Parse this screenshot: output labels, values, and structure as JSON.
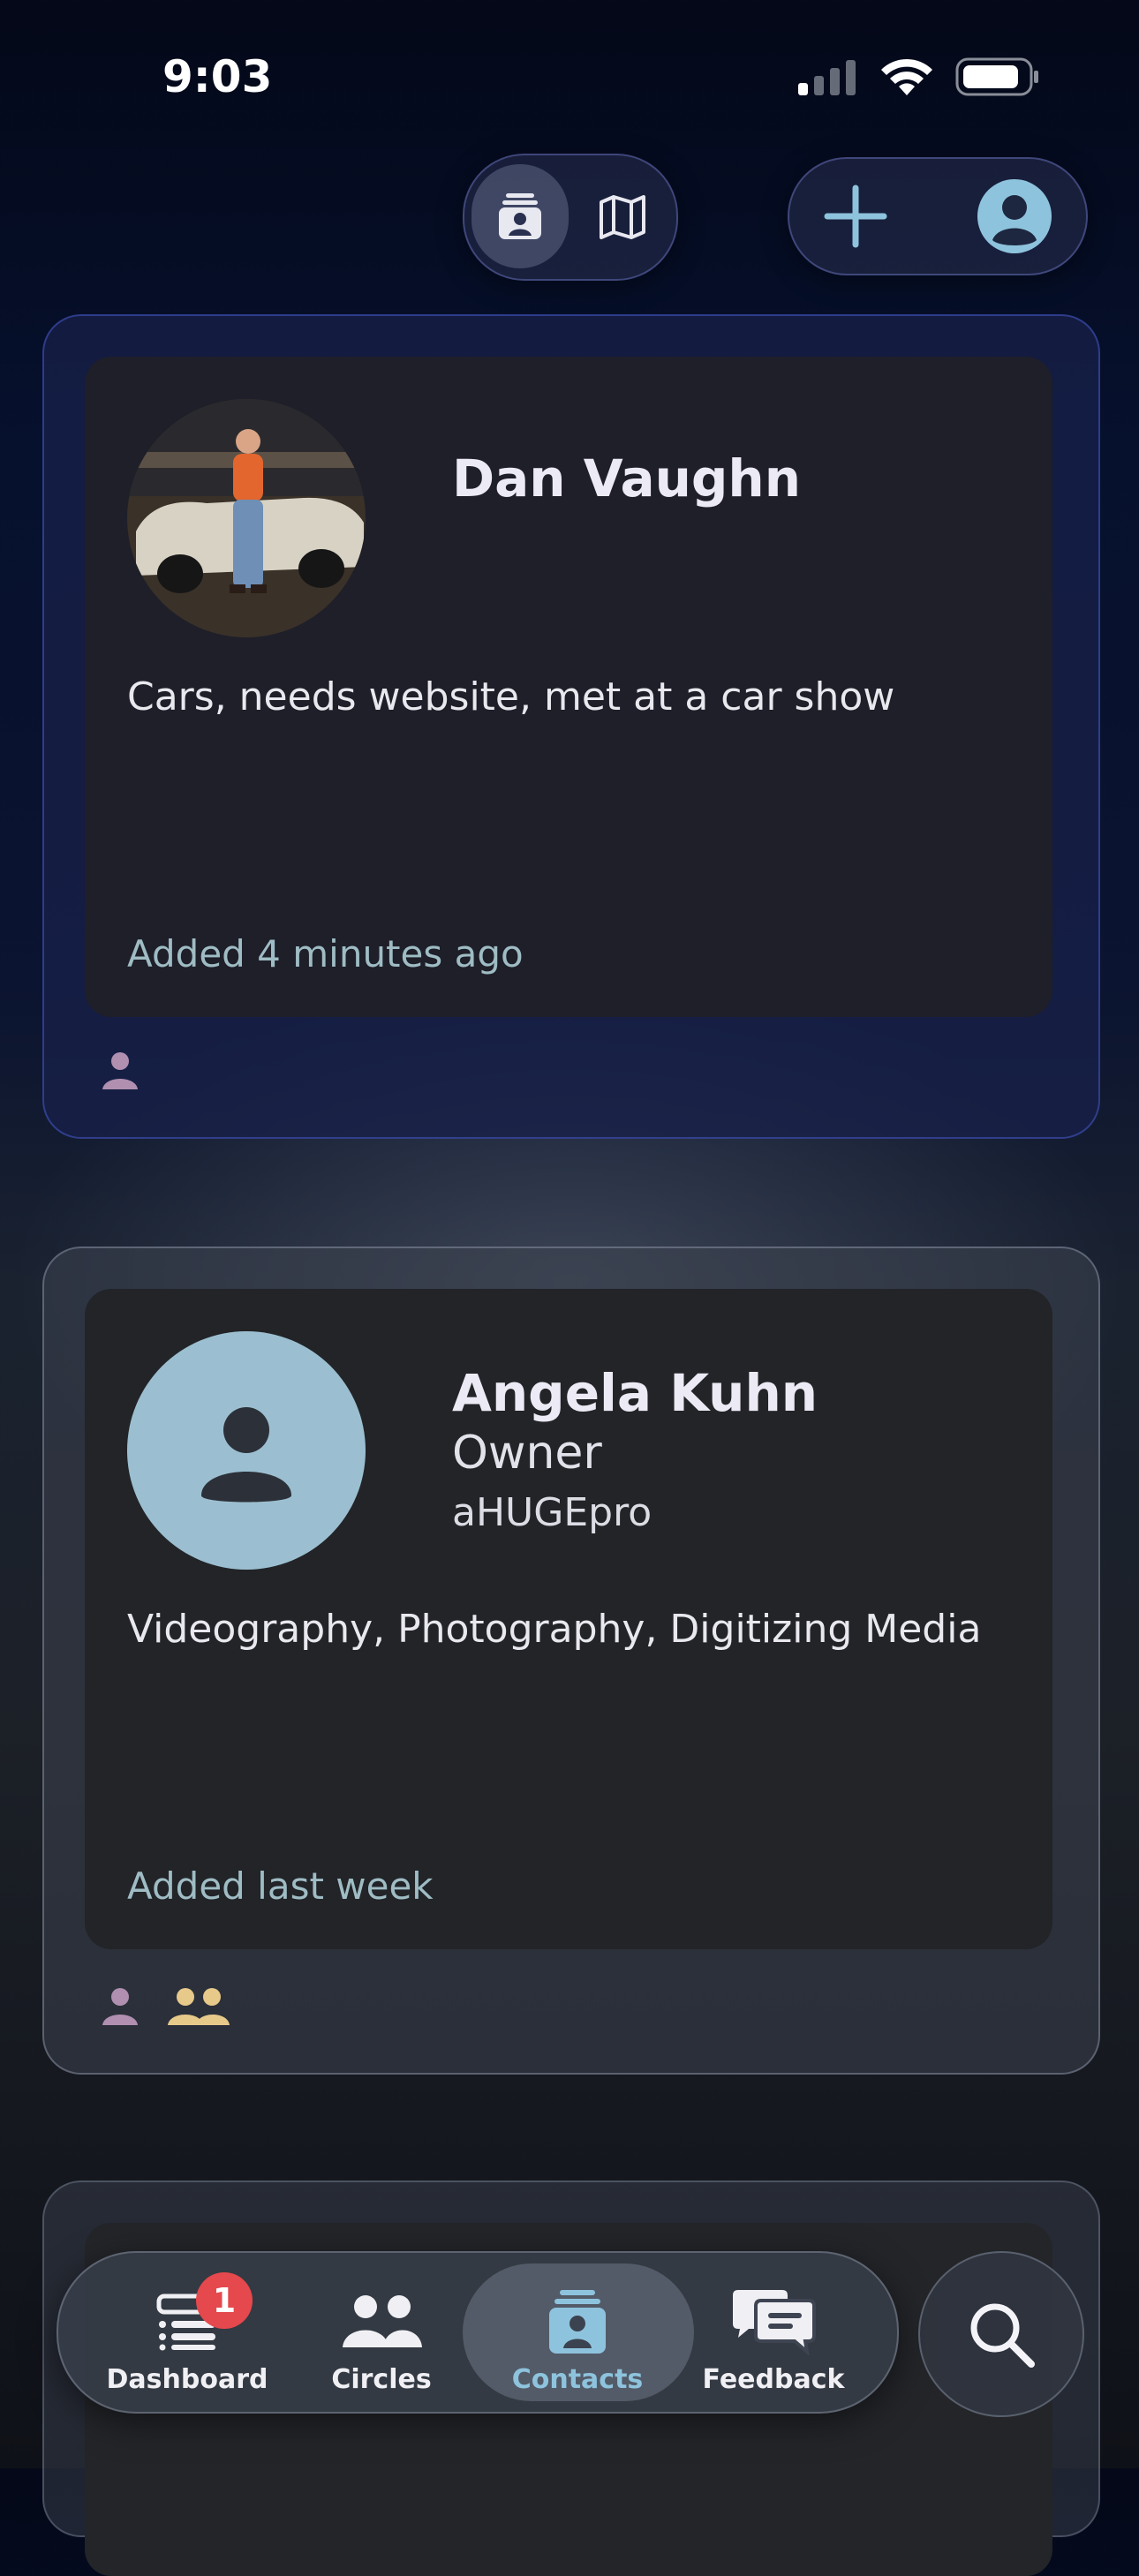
{
  "status": {
    "time": "9:03"
  },
  "colors": {
    "accent": "#8ec3dd",
    "badge": "#e5484d",
    "personTag": "#b08fb0",
    "groupTag": "#e7c98a"
  },
  "contacts": [
    {
      "name": "Dan Vaughn",
      "note": "Cars, needs website, met at a car show",
      "added": "Added 4 minutes ago",
      "tags": [
        "person-icon"
      ]
    },
    {
      "name": "Angela Kuhn",
      "role": "Owner",
      "company": "aHUGEpro",
      "note": "Videography, Photography, Digitizing Media",
      "added": "Added last week",
      "tags": [
        "person-icon",
        "group-icon"
      ]
    }
  ],
  "tabs": [
    {
      "label": "Dashboard",
      "icon": "dashboard-icon",
      "badge": "1"
    },
    {
      "label": "Circles",
      "icon": "circles-icon"
    },
    {
      "label": "Contacts",
      "icon": "contacts-icon",
      "active": true
    },
    {
      "label": "Feedback",
      "icon": "feedback-icon"
    }
  ]
}
